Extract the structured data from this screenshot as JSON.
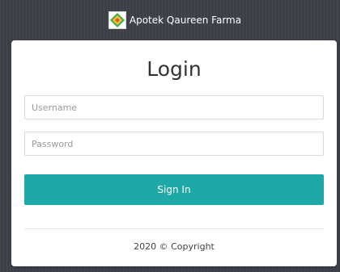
{
  "header": {
    "brand_name": "Apotek Qaureen Farma",
    "logo_icon": "pharmacy-logo-icon"
  },
  "login": {
    "title": "Login",
    "username_placeholder": "Username",
    "password_placeholder": "Password",
    "submit_label": "Sign In",
    "accent_color": "#1fa9a6"
  },
  "footer": {
    "copyright": "2020 © Copyright"
  }
}
